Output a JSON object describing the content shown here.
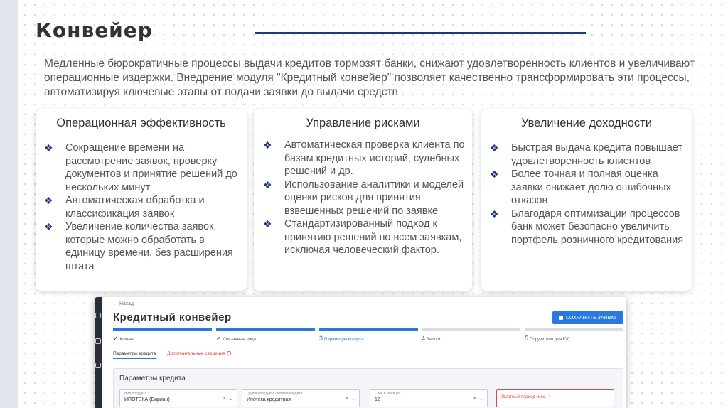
{
  "slide": {
    "title": "Конвейер",
    "intro": "Медленные бюрократичные процессы выдачи кредитов тормозят банки, снижают удовлетворенность клиентов и увеличивают операционные издержки. Внедрение модуля \"Кредитный конвейер\" позволяет качественно трансформировать эти процессы, автоматизируя ключевые этапы от подачи заявки до выдачи средств",
    "bullet_icon": "diamond-bullet-icon",
    "accent_color": "#1f3a7a"
  },
  "cards": [
    {
      "title": "Операционная эффективность",
      "items": [
        "Сокращение времени на рассмотрение заявок, проверку документов и принятие решений до нескольких минут",
        "Автоматическая обработка и классификация заявок",
        "Увеличение количества заявок, которые можно обработать в единицу времени, без расширения штата"
      ]
    },
    {
      "title": "Управление рисками",
      "items": [
        "Автоматическая проверка клиента по базам кредитных историй, судебных решений и др.",
        "Использование аналитики и моделей оценки рисков для принятия взвешенных решений по заявке",
        "Стандартизированный подход к принятию решений по всем заявкам, исключая человеческий фактор."
      ]
    },
    {
      "title": "Увеличение доходности",
      "items": [
        "Быстрая выдача кредита повышает удовлетворенность клиентов",
        "Более точная и полная оценка заявки снижает долю ошибочных отказов",
        "Благодаря оптимизации процессов банк может безопасно увеличить портфель розничного кредитования"
      ]
    }
  ],
  "app": {
    "back_label": "← Назад",
    "title": "Кредитный конвейер",
    "save_button": "СОХРАНИТЬ ЗАЯВКУ",
    "primary_color": "#2979e0",
    "steps": [
      {
        "num": "✓",
        "label": "Клиент",
        "state": "done"
      },
      {
        "num": "✓",
        "label": "Связанные лица",
        "state": "done"
      },
      {
        "num": "3",
        "label": "Параметры кредита",
        "state": "active"
      },
      {
        "num": "4",
        "label": "Залоги",
        "state": "todo"
      },
      {
        "num": "5",
        "label": "Поручители для ЮЛ",
        "state": "todo"
      }
    ],
    "tabs": [
      {
        "label": "Параметры кредита",
        "state": "active"
      },
      {
        "label": "Дополнительные сведения",
        "state": "warning"
      }
    ],
    "section_title": "Параметры кредита",
    "fields": [
      {
        "label": "Вид продукта *",
        "value": "ИПОТЕКА (Бирлан)"
      },
      {
        "label": "Группы продукта / Форма кредита",
        "value": "Ипотека кредитная"
      },
      {
        "label": "Срок в месяцах *",
        "value": "12"
      },
      {
        "label": "Льготный период (мес.) *",
        "value": ""
      }
    ]
  }
}
